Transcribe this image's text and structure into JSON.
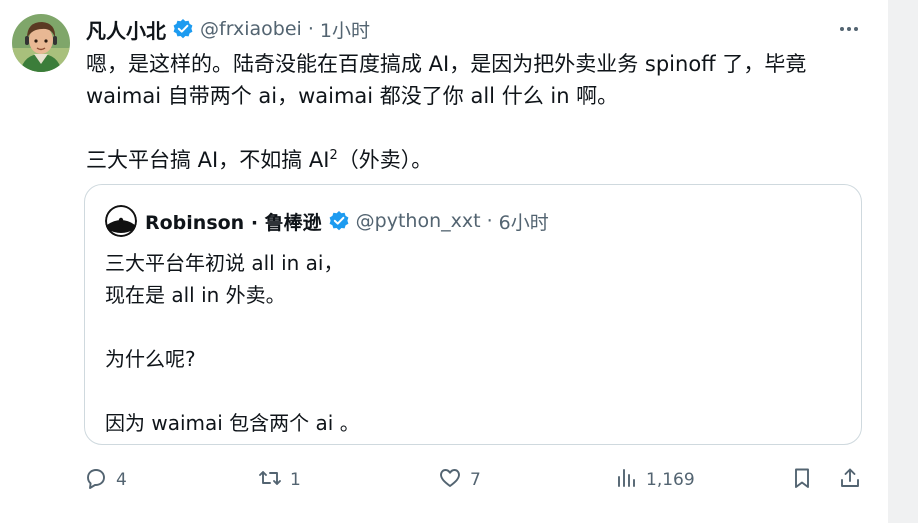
{
  "tweet": {
    "author": {
      "name": "凡人小北",
      "handle": "@frxiaobei",
      "separator": "·",
      "time": "1小时"
    },
    "text": {
      "line1": "嗯，是这样的。陆奇没能在百度搞成 AI，是因为把外卖业务 spinoff 了，毕竟",
      "line2": "waimai 自带两个 ai，waimai 都没了你 all 什么 in 啊。",
      "line3_pre": "三大平台搞 AI，不如搞 AI",
      "line3_sup": "2",
      "line3_post": "（外卖）。"
    },
    "more_icon": "ellipsis-icon"
  },
  "quote": {
    "author": {
      "name": "Robinson · 鲁棒逊",
      "handle": "@python_xxt",
      "separator": "·",
      "time": "6小时"
    },
    "lines": [
      "三大平台年初说 all in ai，",
      "现在是 all in 外卖。",
      "为什么呢?",
      "因为 waimai  包含两个 ai 。"
    ]
  },
  "actions": {
    "reply": {
      "icon": "reply-icon",
      "count": "4"
    },
    "retweet": {
      "icon": "retweet-icon",
      "count": "1"
    },
    "like": {
      "icon": "heart-icon",
      "count": "7"
    },
    "views": {
      "icon": "analytics-icon",
      "count": "1,169"
    },
    "bookmark": {
      "icon": "bookmark-icon"
    },
    "share": {
      "icon": "share-icon"
    }
  },
  "colors": {
    "verified": "#1d9bf0",
    "muted": "#536471",
    "text": "#0f1419",
    "border": "#cfd9de"
  }
}
